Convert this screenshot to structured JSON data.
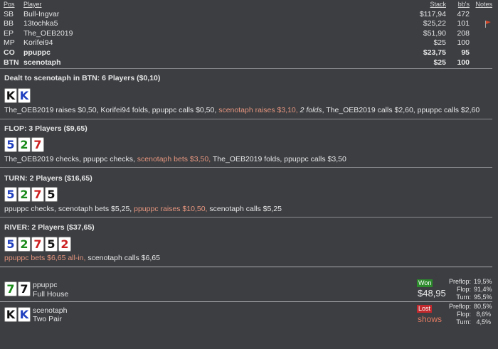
{
  "header": {
    "pos": "Pos",
    "player": "Player",
    "stack": "Stack",
    "bbs": "bb's",
    "notes": "Notes"
  },
  "players": [
    {
      "pos": "SB",
      "name": "Bull-Ingvar",
      "stack": "$117,94",
      "bb": "472",
      "bold": false,
      "flag": false
    },
    {
      "pos": "BB",
      "name": "13tochka5",
      "stack": "$25,22",
      "bb": "101",
      "bold": false,
      "flag": true
    },
    {
      "pos": "EP",
      "name": "The_OEB2019",
      "stack": "$51,90",
      "bb": "208",
      "bold": false,
      "flag": false
    },
    {
      "pos": "MP",
      "name": "Korifei94",
      "stack": "$25",
      "bb": "100",
      "bold": false,
      "flag": false
    },
    {
      "pos": "CO",
      "name": "ppuppc",
      "stack": "$23,75",
      "bb": "95",
      "bold": true,
      "flag": false
    },
    {
      "pos": "BTN",
      "name": "scenotaph",
      "stack": "$25",
      "bb": "100",
      "bold": true,
      "flag": false
    }
  ],
  "preflop": {
    "title": "Dealt to scenotaph in BTN: 6 Players ($0,10)",
    "cards": [
      {
        "rank": "K",
        "color": "black"
      },
      {
        "rank": "K",
        "color": "blue"
      }
    ],
    "actions": [
      {
        "text": "The_OEB2019 raises $0,50, Korifei94 folds, ppuppc calls $0,50, ",
        "style": "normal"
      },
      {
        "text": "scenotaph raises $3,10,",
        "style": "hero"
      },
      {
        "text": " ",
        "style": "normal"
      },
      {
        "text": "2 folds",
        "style": "italic"
      },
      {
        "text": ", The_OEB2019 calls $2,60, ppuppc calls $2,60",
        "style": "normal"
      }
    ]
  },
  "flop": {
    "title": "FLOP: 3 Players ($9,65)",
    "cards": [
      {
        "rank": "5",
        "color": "blue"
      },
      {
        "rank": "2",
        "color": "green"
      },
      {
        "rank": "7",
        "color": "red"
      }
    ],
    "actions": [
      {
        "text": "The_OEB2019 checks, ppuppc checks, ",
        "style": "normal"
      },
      {
        "text": "scenotaph bets $3,50,",
        "style": "hero"
      },
      {
        "text": " The_OEB2019 folds, ppuppc calls $3,50",
        "style": "normal"
      }
    ]
  },
  "turn": {
    "title": "TURN: 2 Players ($16,65)",
    "cards": [
      {
        "rank": "5",
        "color": "blue"
      },
      {
        "rank": "2",
        "color": "green"
      },
      {
        "rank": "7",
        "color": "red"
      },
      {
        "rank": "5",
        "color": "black"
      }
    ],
    "actions": [
      {
        "text": "ppuppc checks, scenotaph bets $5,25, ",
        "style": "normal"
      },
      {
        "text": "ppuppc raises $10,50,",
        "style": "hero"
      },
      {
        "text": " scenotaph calls $5,25",
        "style": "normal"
      }
    ]
  },
  "river": {
    "title": "RIVER: 2 Players ($37,65)",
    "cards": [
      {
        "rank": "5",
        "color": "blue"
      },
      {
        "rank": "2",
        "color": "green"
      },
      {
        "rank": "7",
        "color": "red"
      },
      {
        "rank": "5",
        "color": "black"
      },
      {
        "rank": "2",
        "color": "red"
      }
    ],
    "actions": [
      {
        "text": "ppuppc bets $6,65 all-in,",
        "style": "hero"
      },
      {
        "text": " scenotaph calls $6,65",
        "style": "normal"
      }
    ]
  },
  "results": [
    {
      "name": "ppuppc",
      "hand": "Full House",
      "cards": [
        {
          "rank": "7",
          "color": "green"
        },
        {
          "rank": "7",
          "color": "black"
        }
      ],
      "badge": "Won",
      "badge_type": "won",
      "amount": "$48,95",
      "shows": "",
      "equity": [
        {
          "label": "Preflop:",
          "value": "19,5%"
        },
        {
          "label": "Flop:",
          "value": "91,4%"
        },
        {
          "label": "Turn:",
          "value": "95,5%"
        }
      ]
    },
    {
      "name": "scenotaph",
      "hand": "Two Pair",
      "cards": [
        {
          "rank": "K",
          "color": "black"
        },
        {
          "rank": "K",
          "color": "blue"
        }
      ],
      "badge": "Lost",
      "badge_type": "lost",
      "amount": "",
      "shows": "shows",
      "equity": [
        {
          "label": "Preflop:",
          "value": "80,5%"
        },
        {
          "label": "Flop:",
          "value": "8,6%"
        },
        {
          "label": "Turn:",
          "value": "4,5%"
        }
      ]
    }
  ],
  "colors": {
    "background": "#3c3e42",
    "hero_action": "#e6957e",
    "won": "#2c8a2c",
    "lost": "#c0292d",
    "flag": "#d84a2a"
  }
}
